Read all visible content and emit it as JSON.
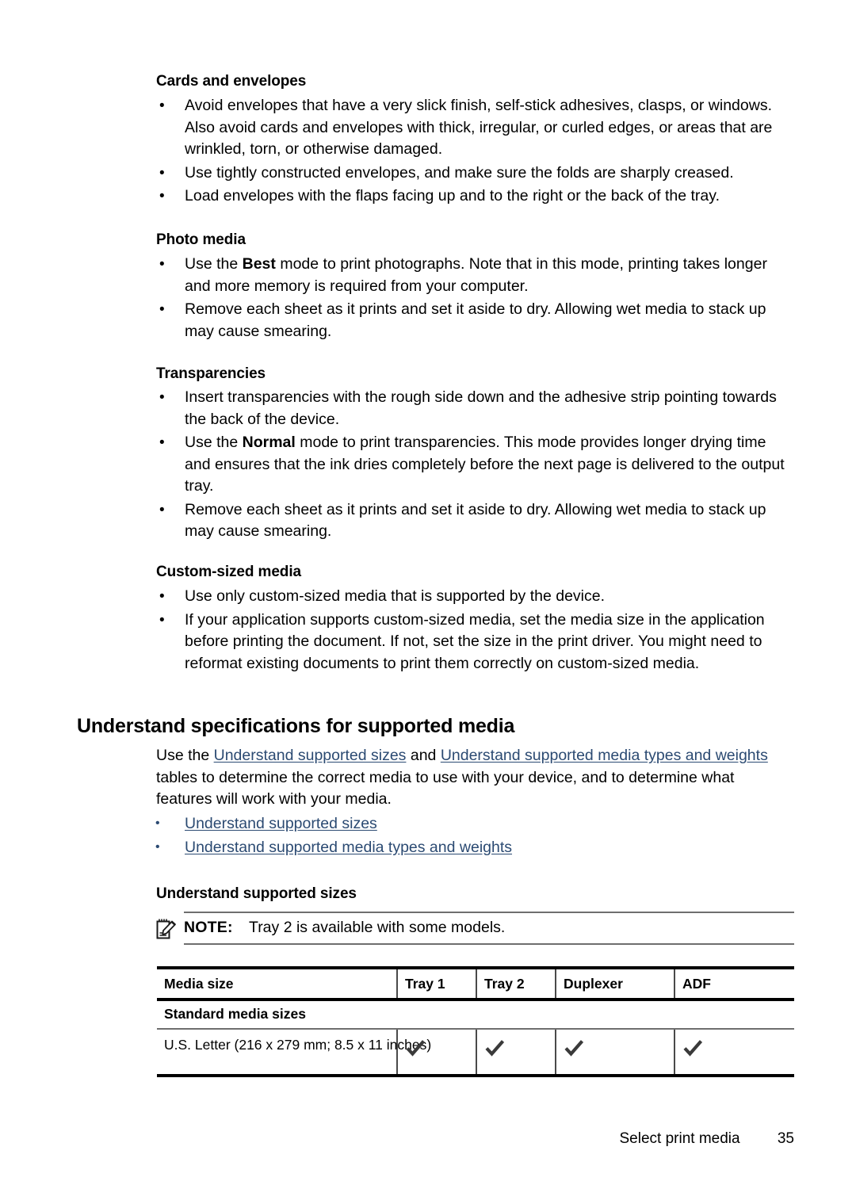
{
  "sections": [
    {
      "heading": "Cards and envelopes",
      "bullets": [
        "Avoid envelopes that have a very slick finish, self-stick adhesives, clasps, or windows. Also avoid cards and envelopes with thick, irregular, or curled edges, or areas that are wrinkled, torn, or otherwise damaged.",
        "Use tightly constructed envelopes, and make sure the folds are sharply creased.",
        "Load envelopes with the flaps facing up and to the right or the back of the tray."
      ]
    },
    {
      "heading": "Photo media",
      "bullets": [
        "Use the <b>Best</b> mode to print photographs. Note that in this mode, printing takes longer and more memory is required from your computer.",
        "Remove each sheet as it prints and set it aside to dry. Allowing wet media to stack up may cause smearing."
      ]
    },
    {
      "heading": "Transparencies",
      "bullets": [
        "Insert transparencies with the rough side down and the adhesive strip pointing towards the back of the device.",
        "Use the <b>Normal</b> mode to print transparencies. This mode provides longer drying time and ensures that the ink dries completely before the next page is delivered to the output tray.",
        "Remove each sheet as it prints and set it aside to dry. Allowing wet media to stack up may cause smearing."
      ]
    },
    {
      "heading": "Custom-sized media",
      "bullets": [
        "Use only custom-sized media that is supported by the device.",
        "If your application supports custom-sized media, set the media size in the application before printing the document. If not, set the size in the print driver. You might need to reformat existing documents to print them correctly on custom-sized media."
      ]
    }
  ],
  "chapter": {
    "heading": "Understand specifications for supported media",
    "intro_html": "Use the <a class=\"doclink\" href=\"#\" data-name=\"link-understand-supported-sizes-inline\" data-interactable=\"true\">Understand supported sizes</a> and <a class=\"doclink\" href=\"#\" data-name=\"link-understand-supported-media-types-inline\" data-interactable=\"true\">Understand supported media types and weights</a> tables to determine the correct media to use with your device, and to determine what features will work with your media.",
    "links": [
      "Understand supported sizes",
      "Understand supported media types and weights"
    ]
  },
  "subsection": {
    "heading": "Understand supported sizes",
    "note": {
      "label": "NOTE:",
      "text": "Tray 2 is available with some models.",
      "icon": "note-pencil-icon"
    }
  },
  "table": {
    "columns": [
      "Media size",
      "Tray 1",
      "Tray 2",
      "Duplexer",
      "ADF"
    ],
    "groups": [
      {
        "title": "Standard media sizes",
        "rows": [
          {
            "label": "U.S. Letter (216 x 279 mm; 8.5 x 11 inches)",
            "values": [
              "check",
              "check",
              "check",
              "check"
            ]
          }
        ]
      }
    ]
  },
  "footer": {
    "text": "Select print media",
    "page": "35"
  },
  "colors": {
    "link": "#2b4a72",
    "rule": "#6e6e6e",
    "heavy_rule": "#000000",
    "text": "#000000"
  },
  "icons": {
    "bullet": "•",
    "check": "check-mark-icon"
  }
}
